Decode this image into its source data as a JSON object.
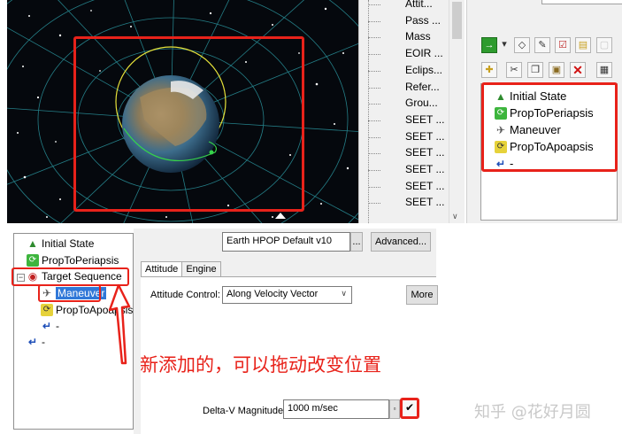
{
  "colors": {
    "highlight": "#e8221a",
    "selection": "#3078d8",
    "space": "#05080d",
    "orbit_yellow": "#e6e23a",
    "orbit_green": "#36d24a"
  },
  "object_list": {
    "items": [
      "Attit...",
      "Pass ...",
      "Mass",
      "EOIR ...",
      "Eclips...",
      "Refer...",
      "Grou...",
      "SEET ...",
      "SEET ...",
      "SEET ...",
      "SEET ...",
      "SEET ...",
      "SEET ..."
    ]
  },
  "toolbar": {
    "row1": [
      "run-arrow-icon",
      "dropdown-icon",
      "diamond-icon",
      "tools-icon",
      "checklist-icon",
      "notes-icon",
      "disabled-icon"
    ],
    "row2": [
      "new-segment-icon",
      "cut-icon",
      "copy-icon",
      "paste-icon",
      "delete-icon",
      "summary-icon"
    ]
  },
  "mcs_tree_top": [
    {
      "label": "Initial State",
      "icon": "initial-state-icon"
    },
    {
      "label": "PropToPeriapsis",
      "icon": "propagate-icon"
    },
    {
      "label": "Maneuver",
      "icon": "maneuver-icon"
    },
    {
      "label": "PropToApoapsis",
      "icon": "propagate-icon"
    },
    {
      "label": "-",
      "icon": "return-icon"
    }
  ],
  "mcs_tree_bottom": {
    "initial": "Initial State",
    "prop1": "PropToPeriapsis",
    "target": "Target Sequence",
    "expander": "−",
    "maneuver": "Maneuver",
    "prop2": "PropToApoapsis",
    "end_inner": "-",
    "end_outer": "-"
  },
  "props": {
    "propagator_value": "Earth HPOP Default v10",
    "ellipsis": "...",
    "advanced_label": "Advanced...",
    "tabs": [
      "Attitude",
      "Engine"
    ],
    "attitude_control_label": "Attitude Control:",
    "attitude_control_value": "Along Velocity Vector",
    "more_label": "More",
    "dv_label": "Delta-V Magnitude:",
    "dv_value": "1000 m/sec"
  },
  "annotation": "新添加的，可以拖动改变位置",
  "watermark": "知乎 @花好月圆"
}
